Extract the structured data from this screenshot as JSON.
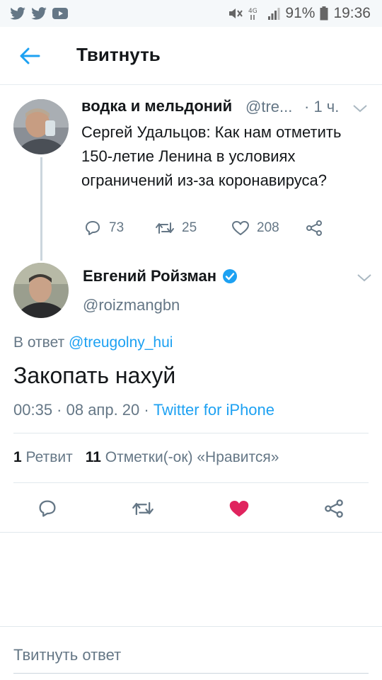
{
  "status_bar": {
    "battery": "91%",
    "time": "19:36",
    "network": "4G",
    "left_icons": [
      "twitter-icon",
      "twitter-icon",
      "youtube-icon"
    ]
  },
  "header": {
    "title": "Твитнуть",
    "back_icon": "arrow-left-icon"
  },
  "parent_tweet": {
    "name": "водка и мельдоний",
    "handle": "@tre...",
    "time": "· 1 ч.",
    "text": "Сергей Удальцов: Как нам отметить 150-летие Ленина в условиях ограничений из-за коронавируса?",
    "replies": "73",
    "retweets": "25",
    "likes": "208"
  },
  "main_tweet": {
    "name": "Евгений Ройзман",
    "verified": true,
    "handle": "@roizmangbn",
    "reply_prefix": "В ответ",
    "reply_to": "@treugolny_hui",
    "text": "Закопать нахуй",
    "datetime": "00:35 · 08 апр. 20 · ",
    "source": "Twitter for iPhone",
    "retweet_count": "1",
    "retweet_label": "Ретвит",
    "like_count": "11",
    "like_label": "Отметки(-ок) «Нравится»",
    "liked": true
  },
  "reply_box": {
    "placeholder": "Твитнуть ответ"
  },
  "colors": {
    "accent": "#1da1f2",
    "like": "#e0245e",
    "muted": "#657786",
    "text": "#14171a"
  }
}
